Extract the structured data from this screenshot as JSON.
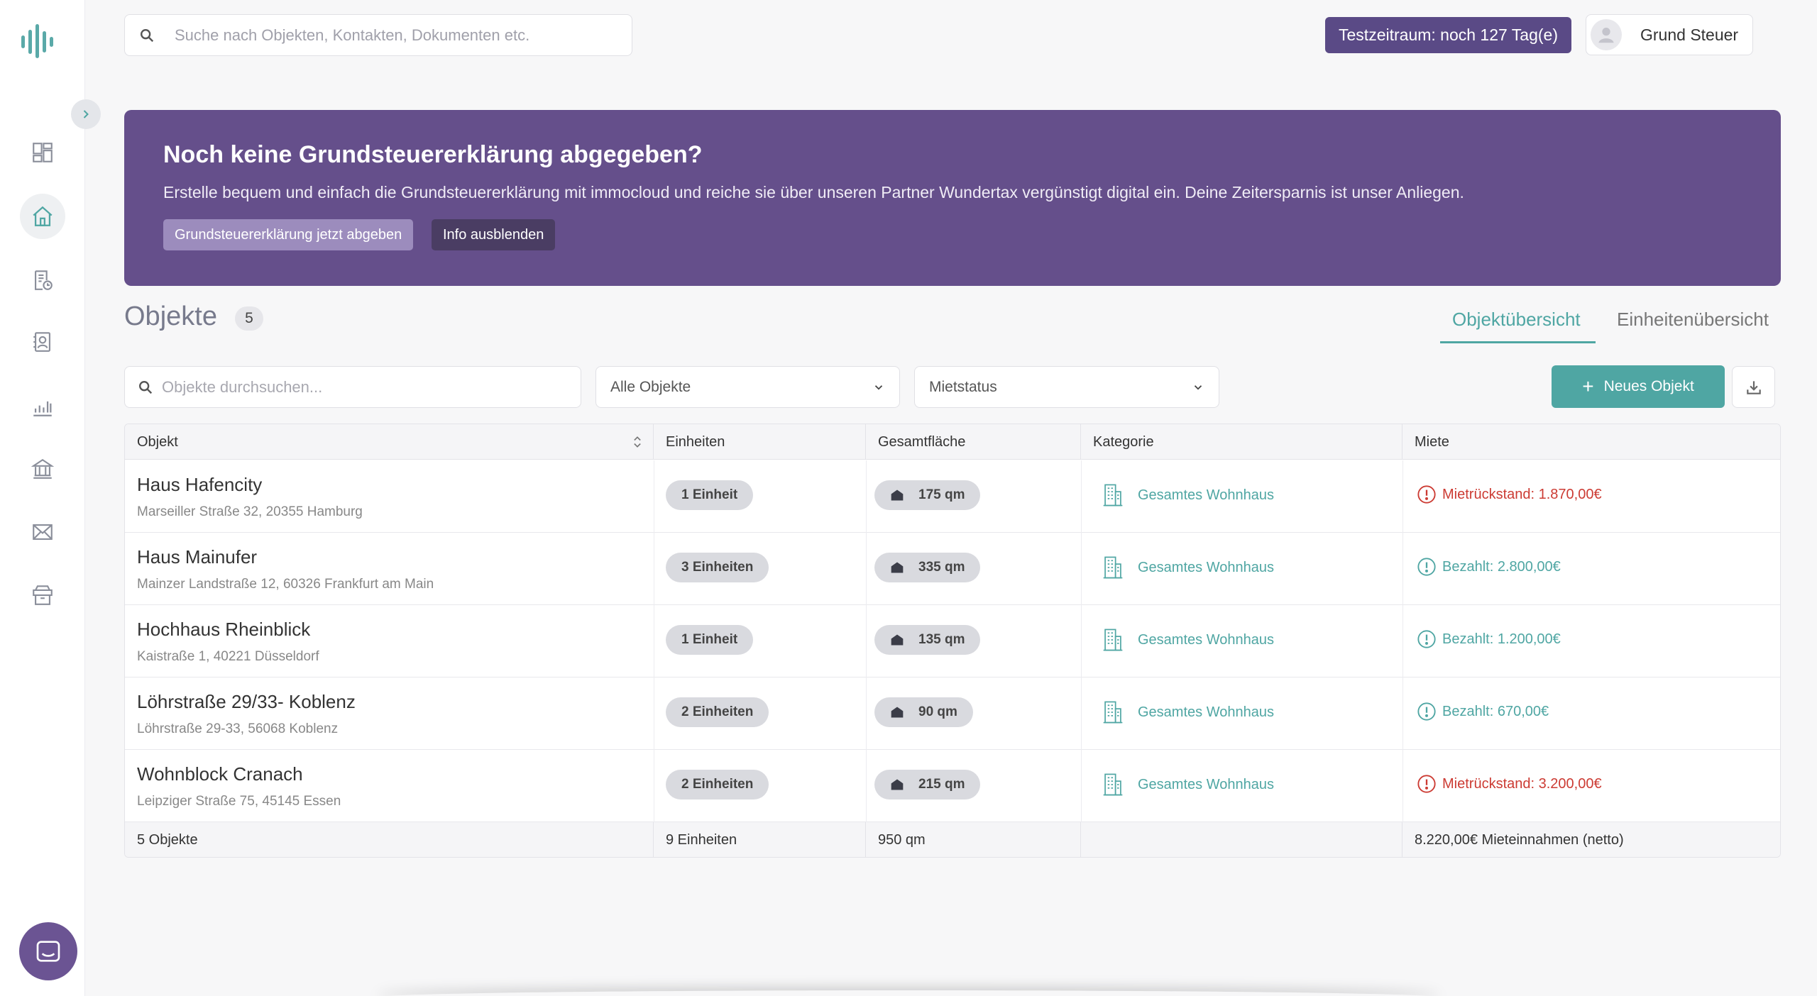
{
  "sidebar": {
    "items": [
      {
        "name": "dashboard-icon"
      },
      {
        "name": "home-icon",
        "active": true
      },
      {
        "name": "receipt-icon"
      },
      {
        "name": "contacts-icon"
      },
      {
        "name": "chart-icon"
      },
      {
        "name": "bank-icon"
      },
      {
        "name": "mail-icon"
      },
      {
        "name": "archive-icon"
      }
    ]
  },
  "header": {
    "search_placeholder": "Suche nach Objekten, Kontakten, Dokumenten etc.",
    "trial_badge": "Testzeitraum: noch 127 Tag(e)",
    "user_name": "Grund Steuer"
  },
  "banner": {
    "title": "Noch keine Grundsteuererklärung abgegeben?",
    "text": "Erstelle bequem und einfach die Grundsteuererklärung mit immocloud und reiche sie über unseren Partner Wundertax vergünstigt digital ein. Deine Zeitersparnis ist unser Anliegen.",
    "primary_label": "Grundsteuererklärung jetzt abgeben",
    "secondary_label": "Info ausblenden"
  },
  "objects": {
    "title": "Objekte",
    "count": "5",
    "tabs": [
      {
        "label": "Objektübersicht",
        "active": true
      },
      {
        "label": "Einheitenübersicht",
        "active": false
      }
    ],
    "search_placeholder": "Objekte durchsuchen...",
    "filter_all": "Alle Objekte",
    "filter_status": "Mietstatus",
    "new_button": "Neues Objekt"
  },
  "table": {
    "columns": [
      "Objekt",
      "Einheiten",
      "Gesamtfläche",
      "Kategorie",
      "Miete"
    ],
    "rows": [
      {
        "name": "Haus Hafencity",
        "address": "Marseiller Straße 32, 20355 Hamburg",
        "units": "1 Einheit",
        "area": "175 qm",
        "category": "Gesamtes Wohnhaus",
        "rent": "Mietrückstand: 1.870,00€",
        "rent_status": "bad"
      },
      {
        "name": "Haus Mainufer",
        "address": "Mainzer Landstraße 12, 60326 Frankfurt am Main",
        "units": "3 Einheiten",
        "area": "335 qm",
        "category": "Gesamtes Wohnhaus",
        "rent": "Bezahlt: 2.800,00€",
        "rent_status": "good"
      },
      {
        "name": "Hochhaus Rheinblick",
        "address": "Kaistraße 1, 40221 Düsseldorf",
        "units": "1 Einheit",
        "area": "135 qm",
        "category": "Gesamtes Wohnhaus",
        "rent": "Bezahlt: 1.200,00€",
        "rent_status": "good"
      },
      {
        "name": "Löhrstraße 29/33- Koblenz",
        "address": "Löhrstraße 29-33, 56068 Koblenz",
        "units": "2 Einheiten",
        "area": "90 qm",
        "category": "Gesamtes Wohnhaus",
        "rent": "Bezahlt: 670,00€",
        "rent_status": "good"
      },
      {
        "name": "Wohnblock Cranach",
        "address": "Leipziger Straße 75, 45145 Essen",
        "units": "2 Einheiten",
        "area": "215 qm",
        "category": "Gesamtes Wohnhaus",
        "rent": "Mietrückstand: 3.200,00€",
        "rent_status": "bad"
      }
    ],
    "footer": {
      "objects": "5 Objekte",
      "units": "9 Einheiten",
      "area": "950 qm",
      "category": "",
      "rent": "8.220,00€ Mieteinnahmen (netto)"
    }
  },
  "colors": {
    "accent": "#4fa6a3",
    "banner": "#654f8b",
    "trial": "#5a4a86",
    "error": "#cc3b33"
  }
}
